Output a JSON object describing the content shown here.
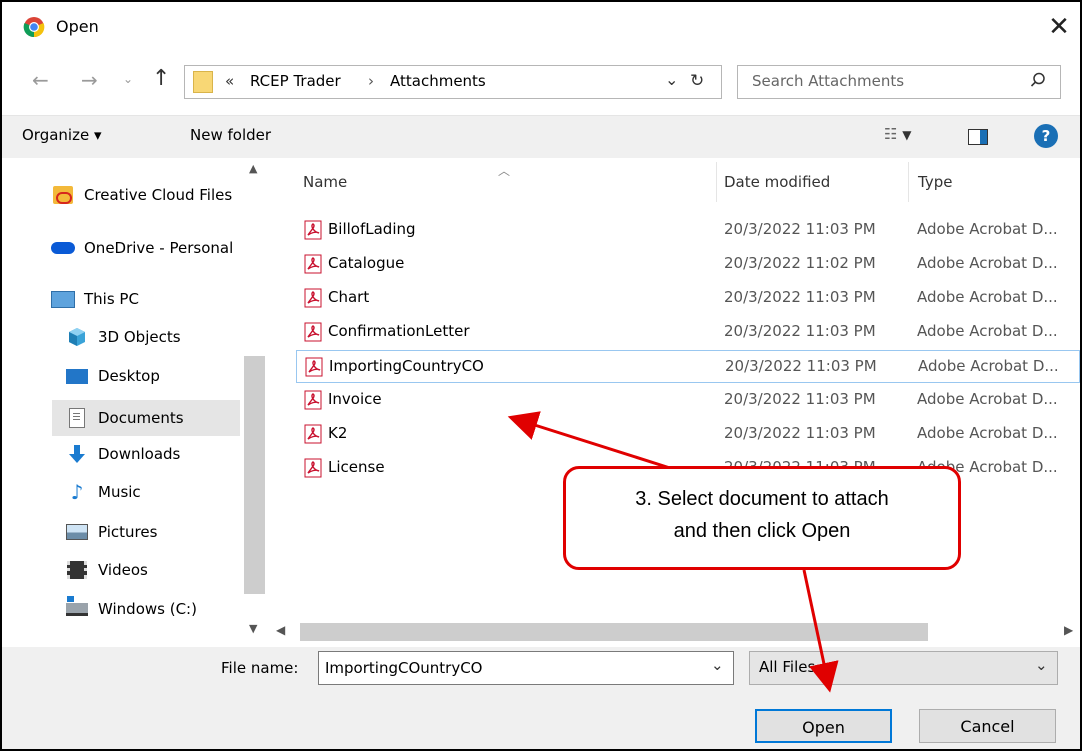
{
  "window": {
    "title": "Open",
    "close_label": "✕"
  },
  "nav": {
    "path": [
      "«",
      "RCEP Trader",
      "›",
      "Attachments"
    ],
    "search_placeholder": "Search Attachments"
  },
  "toolbar": {
    "organize_label": "Organize ▾",
    "new_folder_label": "New folder"
  },
  "sidebar": {
    "items": [
      {
        "label": "Creative Cloud Files",
        "icon": "creative-cloud-icon"
      },
      {
        "label": "OneDrive - Personal",
        "icon": "onedrive-icon"
      },
      {
        "label": "This PC",
        "icon": "pc-icon"
      },
      {
        "label": "3D Objects",
        "icon": "cube-icon"
      },
      {
        "label": "Desktop",
        "icon": "desktop-icon"
      },
      {
        "label": "Documents",
        "icon": "documents-icon"
      },
      {
        "label": "Downloads",
        "icon": "downloads-icon"
      },
      {
        "label": "Music",
        "icon": "music-icon"
      },
      {
        "label": "Pictures",
        "icon": "pictures-icon"
      },
      {
        "label": "Videos",
        "icon": "videos-icon"
      },
      {
        "label": "Windows (C:)",
        "icon": "drive-icon"
      }
    ],
    "selected": "Documents"
  },
  "file_list": {
    "columns": [
      "Name",
      "Date modified",
      "Type"
    ],
    "rows": [
      {
        "name": "BillofLading",
        "date": "20/3/2022 11:03 PM",
        "type": "Adobe Acrobat D..."
      },
      {
        "name": "Catalogue",
        "date": "20/3/2022 11:02 PM",
        "type": "Adobe Acrobat D..."
      },
      {
        "name": "Chart",
        "date": "20/3/2022 11:03 PM",
        "type": "Adobe Acrobat D..."
      },
      {
        "name": "ConfirmationLetter",
        "date": "20/3/2022 11:03 PM",
        "type": "Adobe Acrobat D..."
      },
      {
        "name": "ImportingCountryCO",
        "date": "20/3/2022 11:03 PM",
        "type": "Adobe Acrobat D..."
      },
      {
        "name": "Invoice",
        "date": "20/3/2022 11:03 PM",
        "type": "Adobe Acrobat D..."
      },
      {
        "name": "K2",
        "date": "20/3/2022 11:03 PM",
        "type": "Adobe Acrobat D..."
      },
      {
        "name": "License",
        "date": "20/3/2022 11:03 PM",
        "type": "Adobe Acrobat D..."
      }
    ],
    "selected_row": "ImportingCountryCO"
  },
  "footer": {
    "file_name_label": "File name:",
    "file_name_value": "ImportingCOuntryCO",
    "filter_value": "All Files",
    "open_label": "Open",
    "cancel_label": "Cancel"
  },
  "annotation": {
    "line1": "3. Select document to attach",
    "line2": "and then click Open",
    "color": "#e00000"
  }
}
